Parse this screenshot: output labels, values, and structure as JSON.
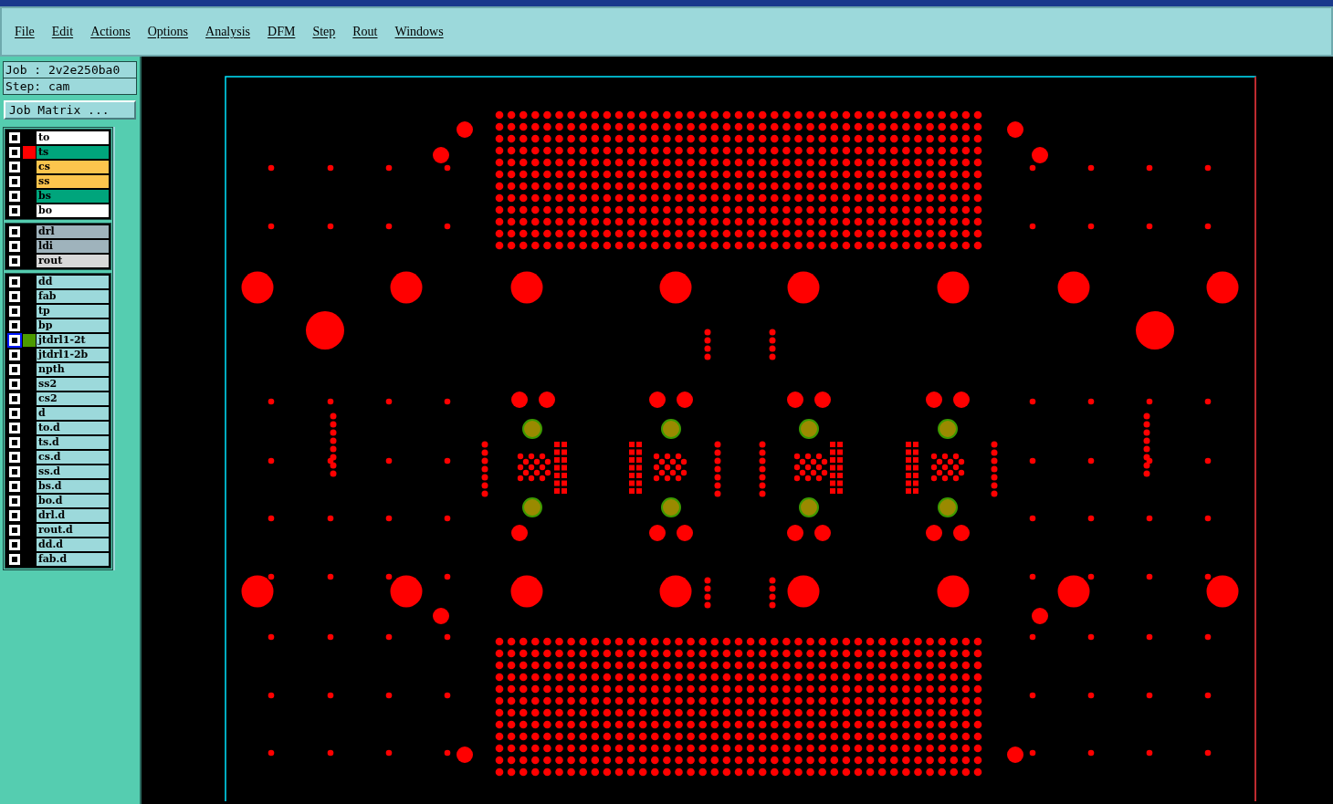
{
  "menu": [
    {
      "label": "File"
    },
    {
      "label": "Edit"
    },
    {
      "label": "Actions"
    },
    {
      "label": "Options"
    },
    {
      "label": "Analysis"
    },
    {
      "label": "DFM"
    },
    {
      "label": "Step"
    },
    {
      "label": "Rout"
    },
    {
      "label": "Windows"
    }
  ],
  "job": {
    "job_line": "Job : 2v2e250ba0",
    "step_line": "Step: cam",
    "matrix_button": "Job Matrix ..."
  },
  "layer_groups": [
    {
      "layers": [
        {
          "name": "to",
          "kind": "overlay",
          "selected": false
        },
        {
          "name": "ts",
          "kind": "mask",
          "selected": false,
          "color": "#ff0000"
        },
        {
          "name": "cs",
          "kind": "signal",
          "selected": false
        },
        {
          "name": "ss",
          "kind": "signal",
          "selected": false
        },
        {
          "name": "bs",
          "kind": "mask",
          "selected": false
        },
        {
          "name": "bo",
          "kind": "overlay",
          "selected": false
        }
      ]
    },
    {
      "layers": [
        {
          "name": "drl",
          "kind": "drill",
          "selected": false
        },
        {
          "name": "ldi",
          "kind": "drill",
          "selected": false
        },
        {
          "name": "rout",
          "kind": "rout",
          "selected": false
        }
      ]
    },
    {
      "layers": [
        {
          "name": "dd",
          "kind": "misc",
          "selected": false
        },
        {
          "name": "fab",
          "kind": "misc",
          "selected": false
        },
        {
          "name": "tp",
          "kind": "misc",
          "selected": false
        },
        {
          "name": "bp",
          "kind": "misc",
          "selected": false
        },
        {
          "name": "jtdrl1-2t",
          "kind": "misc",
          "selected": true,
          "color": "#4c9a00"
        },
        {
          "name": "jtdrl1-2b",
          "kind": "misc",
          "selected": false
        },
        {
          "name": "npth",
          "kind": "misc",
          "selected": false
        },
        {
          "name": "ss2",
          "kind": "misc",
          "selected": false
        },
        {
          "name": "cs2",
          "kind": "misc",
          "selected": false
        },
        {
          "name": "d",
          "kind": "misc",
          "selected": false
        },
        {
          "name": "to.d",
          "kind": "misc",
          "selected": false
        },
        {
          "name": "ts.d",
          "kind": "misc",
          "selected": false
        },
        {
          "name": "cs.d",
          "kind": "misc",
          "selected": false
        },
        {
          "name": "ss.d",
          "kind": "misc",
          "selected": false
        },
        {
          "name": "bs.d",
          "kind": "misc",
          "selected": false
        },
        {
          "name": "bo.d",
          "kind": "misc",
          "selected": false
        },
        {
          "name": "drl.d",
          "kind": "misc",
          "selected": false
        },
        {
          "name": "rout.d",
          "kind": "misc",
          "selected": false
        },
        {
          "name": "dd.d",
          "kind": "misc",
          "selected": false
        },
        {
          "name": "fab.d",
          "kind": "misc",
          "selected": false
        }
      ]
    }
  ]
}
